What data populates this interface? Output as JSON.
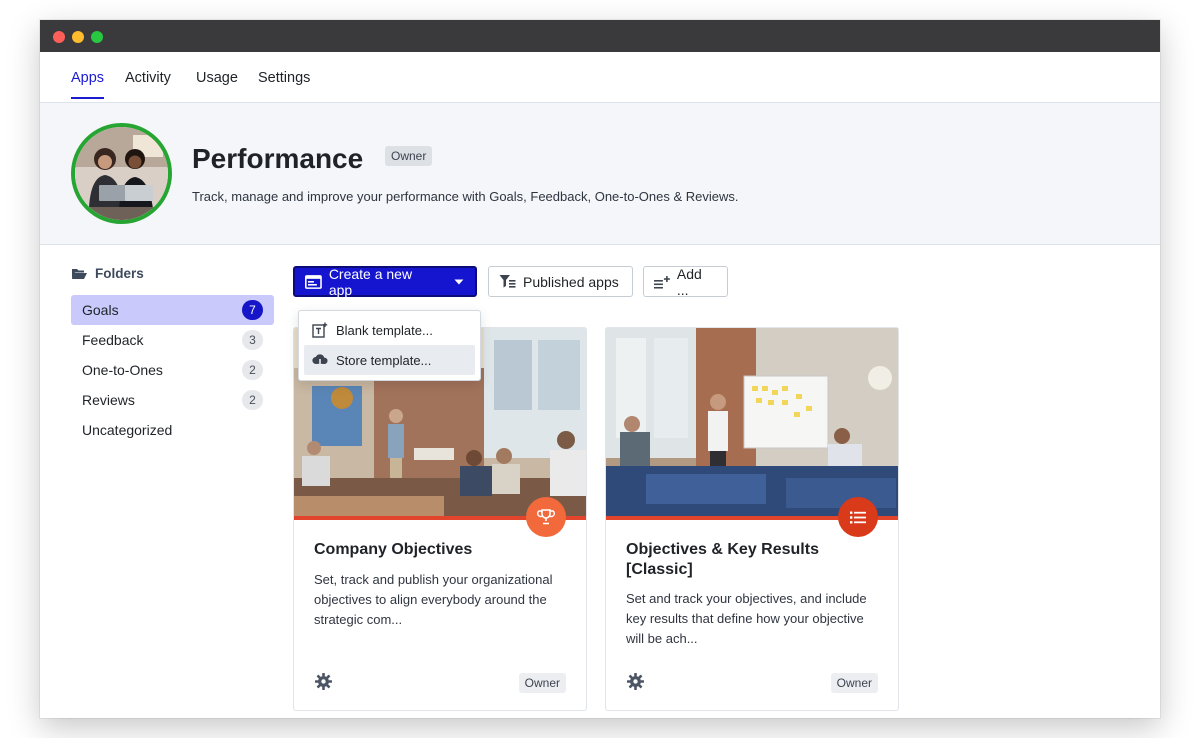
{
  "window": {
    "traffic_lights": [
      "close",
      "minimize",
      "zoom"
    ]
  },
  "nav": {
    "tabs": [
      {
        "label": "Apps",
        "active": true
      },
      {
        "label": "Activity"
      },
      {
        "label": "Usage"
      },
      {
        "label": "Settings"
      }
    ]
  },
  "hero": {
    "title": "Performance",
    "badge": "Owner",
    "description": "Track, manage and improve your performance with Goals, Feedback, One-to-Ones & Reviews."
  },
  "sidebar": {
    "heading": "Folders",
    "heading_icon": "folder-open-icon",
    "items": [
      {
        "label": "Goals",
        "count": "7",
        "active": true
      },
      {
        "label": "Feedback",
        "count": "3"
      },
      {
        "label": "One-to-Ones",
        "count": "2"
      },
      {
        "label": "Reviews",
        "count": "2"
      },
      {
        "label": "Uncategorized",
        "count": ""
      }
    ]
  },
  "toolbar": {
    "create_label": "Create a new app",
    "published_label": "Published apps",
    "add_label": "Add ..."
  },
  "dropdown": {
    "items": [
      {
        "label": "Blank template...",
        "icon": "blank-template-icon"
      },
      {
        "label": "Store template...",
        "icon": "cloud-download-icon"
      }
    ]
  },
  "cards": [
    {
      "title": "Company Objectives",
      "description": "Set, track and publish your organizational objectives to align everybody around the strategic com...",
      "badge_icon": "trophy-icon",
      "owner": "Owner"
    },
    {
      "title": "Objectives & Key Results [Classic]",
      "description": "Set and track your objectives, and include key results that define how your objective will be ach...",
      "badge_icon": "list-icon",
      "owner": "Owner"
    }
  ],
  "colors": {
    "accent": "#1515cf",
    "accent_dark": "#0b0b7a",
    "active_folder": "#c9c9fb",
    "card_stripe": "#e2452b",
    "badge_orange": "#f26a3c",
    "badge_red": "#d83a1a",
    "avatar_ring": "#27a532"
  }
}
